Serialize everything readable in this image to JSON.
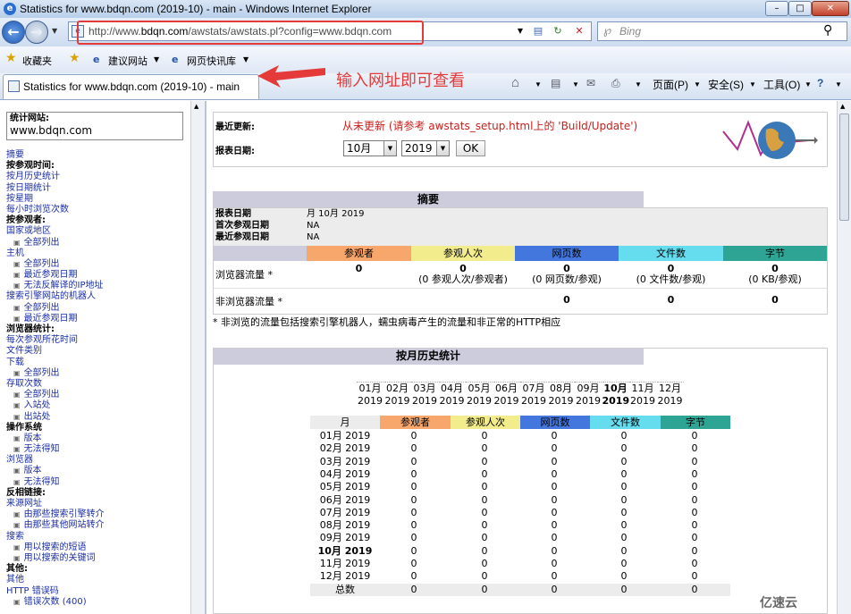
{
  "window": {
    "title": "Statistics for www.bdqn.com (2019-10) - main - Windows Internet Explorer",
    "url_prefix": "http://www.",
    "url_domain": "bdqn.com",
    "url_rest": "/awstats/awstats.pl?config=www.bdqn.com",
    "search_placeholder": "Bing"
  },
  "favbar": {
    "favorites": "收藏夹",
    "suggested": "建议网站",
    "webslice": "网页快讯库"
  },
  "tab": {
    "label": "Statistics for www.bdqn.com (2019-10) - main"
  },
  "annotation": {
    "text": "输入网址即可查看",
    "color": "#e53a3a"
  },
  "commandbar": {
    "page": "页面(P)",
    "safety": "安全(S)",
    "tools": "工具(O)"
  },
  "sidebar": {
    "site_label": "统计网站:",
    "site_value": "www.bdqn.com",
    "items": [
      {
        "t": "link",
        "label": "摘要"
      },
      {
        "t": "head",
        "label": "按参观时间:"
      },
      {
        "t": "link",
        "label": "按月历史统计"
      },
      {
        "t": "link",
        "label": "按日期统计"
      },
      {
        "t": "link",
        "label": "按星期"
      },
      {
        "t": "link",
        "label": "每小时浏览次数"
      },
      {
        "t": "head",
        "label": "按参观者:"
      },
      {
        "t": "link",
        "label": "国家或地区"
      },
      {
        "t": "sub",
        "label": "全部列出"
      },
      {
        "t": "link",
        "label": "主机"
      },
      {
        "t": "sub",
        "label": "全部列出"
      },
      {
        "t": "sub",
        "label": "最近参观日期"
      },
      {
        "t": "sub",
        "label": "无法反解译的IP地址"
      },
      {
        "t": "link",
        "label": "搜索引擎网站的机器人"
      },
      {
        "t": "sub",
        "label": "全部列出"
      },
      {
        "t": "sub",
        "label": "最近参观日期"
      },
      {
        "t": "head",
        "label": "浏览器统计:"
      },
      {
        "t": "link",
        "label": "每次参观所花时间"
      },
      {
        "t": "link",
        "label": "文件类别"
      },
      {
        "t": "link",
        "label": "下载"
      },
      {
        "t": "sub",
        "label": "全部列出"
      },
      {
        "t": "link",
        "label": "存取次数"
      },
      {
        "t": "sub",
        "label": "全部列出"
      },
      {
        "t": "sub",
        "label": "入站处"
      },
      {
        "t": "sub",
        "label": "出站处"
      },
      {
        "t": "head",
        "label": "操作系统"
      },
      {
        "t": "sub",
        "label": "版本"
      },
      {
        "t": "sub",
        "label": "无法得知"
      },
      {
        "t": "link",
        "label": "浏览器"
      },
      {
        "t": "sub",
        "label": "版本"
      },
      {
        "t": "sub",
        "label": "无法得知"
      },
      {
        "t": "head",
        "label": "反相链接:"
      },
      {
        "t": "link",
        "label": "来源网址"
      },
      {
        "t": "sub",
        "label": "由那些搜索引擎转介"
      },
      {
        "t": "sub",
        "label": "由那些其他网站转介"
      },
      {
        "t": "link",
        "label": "搜索"
      },
      {
        "t": "sub",
        "label": "用以搜索的短语"
      },
      {
        "t": "sub",
        "label": "用以搜索的关键词"
      },
      {
        "t": "head",
        "label": "其他:"
      },
      {
        "t": "link",
        "label": "其他"
      },
      {
        "t": "link",
        "label": "HTTP 错误码"
      },
      {
        "t": "sub",
        "label": "错误次数 (400)"
      }
    ]
  },
  "info": {
    "last_update_label": "最近更新:",
    "last_update_value": "从未更新 (请参考 awstats_setup.html上的 'Build/Update')",
    "report_date_label": "报表日期:",
    "month": "10月",
    "year": "2019",
    "ok": "OK"
  },
  "summary": {
    "title": "摘要",
    "report_date_label": "报表日期",
    "report_date_value": "月 10月 2019",
    "first_visit_label": "首次参观日期",
    "first_visit_value": "NA",
    "last_visit_label": "最近参观日期",
    "last_visit_value": "NA",
    "columns": [
      "参观者",
      "参观人次",
      "网页数",
      "文件数",
      "字节"
    ],
    "viewed_label": "浏览器流量 *",
    "viewed": [
      "0",
      "0",
      "0",
      "0",
      "0"
    ],
    "viewed_sub": [
      "",
      "(0 参观人次/参观者)",
      "(0 网页数/参观)",
      "(0 文件数/参观)",
      "(0 KB/参观)"
    ],
    "notviewed_label": "非浏览器流量 *",
    "notviewed": [
      "",
      "",
      "0",
      "0",
      "0"
    ],
    "footnote": "* 非浏览的流量包括搜索引擎机器人，蠕虫病毒产生的流量和非正常的HTTP相应"
  },
  "monthly": {
    "title": "按月历史统计",
    "month_links": [
      {
        "m": "01月",
        "y": "2019"
      },
      {
        "m": "02月",
        "y": "2019"
      },
      {
        "m": "03月",
        "y": "2019"
      },
      {
        "m": "04月",
        "y": "2019"
      },
      {
        "m": "05月",
        "y": "2019"
      },
      {
        "m": "06月",
        "y": "2019"
      },
      {
        "m": "07月",
        "y": "2019"
      },
      {
        "m": "08月",
        "y": "2019"
      },
      {
        "m": "09月",
        "y": "2019"
      },
      {
        "m": "10月",
        "y": "2019"
      },
      {
        "m": "11月",
        "y": "2019"
      },
      {
        "m": "12月",
        "y": "2019"
      }
    ],
    "current_index": 9,
    "headers": [
      "月",
      "参观者",
      "参观人次",
      "网页数",
      "文件数",
      "字节"
    ],
    "rows": [
      [
        "01月 2019",
        "0",
        "0",
        "0",
        "0",
        "0"
      ],
      [
        "02月 2019",
        "0",
        "0",
        "0",
        "0",
        "0"
      ],
      [
        "03月 2019",
        "0",
        "0",
        "0",
        "0",
        "0"
      ],
      [
        "04月 2019",
        "0",
        "0",
        "0",
        "0",
        "0"
      ],
      [
        "05月 2019",
        "0",
        "0",
        "0",
        "0",
        "0"
      ],
      [
        "06月 2019",
        "0",
        "0",
        "0",
        "0",
        "0"
      ],
      [
        "07月 2019",
        "0",
        "0",
        "0",
        "0",
        "0"
      ],
      [
        "08月 2019",
        "0",
        "0",
        "0",
        "0",
        "0"
      ],
      [
        "09月 2019",
        "0",
        "0",
        "0",
        "0",
        "0"
      ],
      [
        "10月 2019",
        "0",
        "0",
        "0",
        "0",
        "0"
      ],
      [
        "11月 2019",
        "0",
        "0",
        "0",
        "0",
        "0"
      ],
      [
        "12月 2019",
        "0",
        "0",
        "0",
        "0",
        "0"
      ],
      [
        "总数",
        "0",
        "0",
        "0",
        "0",
        "0"
      ]
    ]
  },
  "watermark": "亿速云"
}
